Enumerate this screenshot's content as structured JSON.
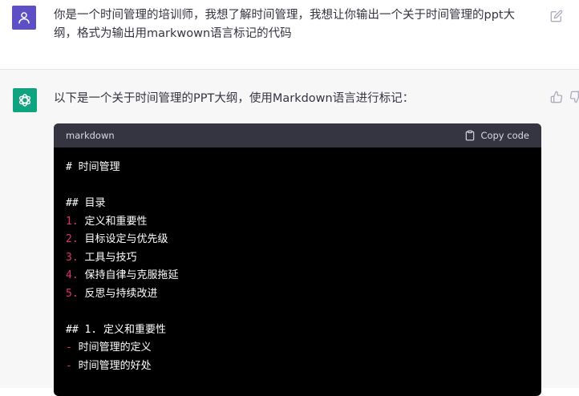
{
  "user_message": {
    "text": "你是一个时间管理的培训师，我想了解时间管理，我想让你输出一个关于时间管理的ppt大纲，格式为输出用markwown语言标记的代码"
  },
  "assistant_message": {
    "intro": "以下是一个关于时间管理的PPT大纲，使用Markdown语言进行标记：",
    "code": {
      "language": "markdown",
      "copy_label": "Copy code",
      "h1": "# 时间管理",
      "toc_heading": "## 目录",
      "toc_items": [
        {
          "num": "1.",
          "text": "定义和重要性"
        },
        {
          "num": "2.",
          "text": "目标设定与优先级"
        },
        {
          "num": "3.",
          "text": "工具与技巧"
        },
        {
          "num": "4.",
          "text": "保持自律与克服拖延"
        },
        {
          "num": "5.",
          "text": "反思与持续改进"
        }
      ],
      "section1_heading": "## 1. 定义和重要性",
      "section1_items": [
        {
          "bullet": "-",
          "text": "时间管理的定义"
        },
        {
          "bullet": "-",
          "text": "时间管理的好处"
        }
      ]
    }
  },
  "icons": {
    "user_avatar": "user-icon",
    "assistant_avatar": "openai-logo-icon",
    "edit": "edit-icon",
    "copy": "clipboard-icon",
    "thumb_up": "thumbs-up-icon",
    "thumb_down": "thumbs-down-icon"
  },
  "colors": {
    "user_avatar_bg": "#5f4fc7",
    "assistant_avatar_bg": "#10a37f",
    "code_bg": "#000000",
    "code_header_bg": "#343541",
    "list_number": "#df3079"
  }
}
